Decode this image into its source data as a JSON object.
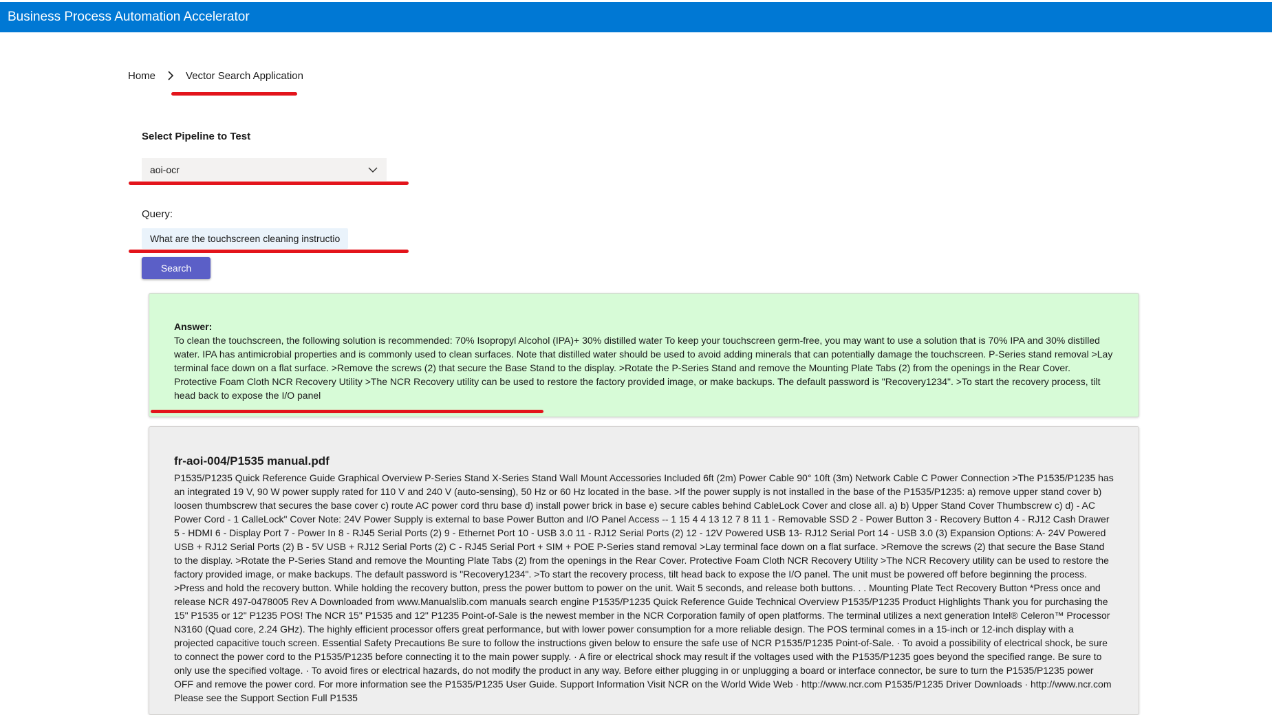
{
  "header": {
    "title": "Business Process Automation Accelerator"
  },
  "breadcrumb": {
    "home": "Home",
    "current": "Vector Search Application"
  },
  "pipeline": {
    "label": "Select Pipeline to Test",
    "selected": "aoi-ocr"
  },
  "query": {
    "label": "Query:",
    "value": "What are the touchscreen cleaning instructio"
  },
  "search_button": {
    "label": "Search"
  },
  "answer": {
    "label": "Answer:",
    "text": "To clean the touchscreen, the following solution is recommended: 70% Isopropyl Alcohol (IPA)+ 30% distilled water To keep your touchscreen germ-free, you may want to use a solution that is 70% IPA and 30% distilled water. IPA has antimicrobial properties and is commonly used to clean surfaces. Note that distilled water should be used to avoid adding minerals that can potentially damage the touchscreen. P-Series stand removal >Lay terminal face down on a flat surface. >Remove the screws (2) that secure the Base Stand to the display. >Rotate the P-Series Stand and remove the Mounting Plate Tabs (2) from the openings in the Rear Cover. Protective Foam Cloth NCR Recovery Utility >The NCR Recovery utility can be used to restore the factory provided image, or make backups. The default password is \"Recovery1234\". >To start the recovery process, tilt head back to expose the I/O panel"
  },
  "result": {
    "title": "fr-aoi-004/P1535 manual.pdf",
    "text": "P1535/P1235 Quick Reference Guide Graphical Overview P-Series Stand X-Series Stand Wall Mount Accessories Included 6ft (2m) Power Cable 90° 10ft (3m) Network Cable C Power Connection >The P1535/P1235 has an integrated 19 V, 90 W power supply rated for 110 V and 240 V (auto-sensing), 50 Hz or 60 Hz located in the base. >If the power supply is not installed in the base of the P1535/P1235: a) remove upper stand cover b) loosen thumbscrew that secures the base cover c) route AC power cord thru base d) install power brick in base e) secure cables behind CableLock Cover and close all. a) b) Upper Stand Cover Thumbscrew c) d) - AC Power Cord - 1 CalleLock\" Cover Note: 24V Power Supply is external to base Power Button and I/O Panel Access -- 1 15 4 4 13 12 7 8 11 1 - Removable SSD 2 - Power Button 3 - Recovery Button 4 - RJ12 Cash Drawer 5 - HDMI 6 - Display Port 7 - Power In 8 - RJ45 Serial Ports (2) 9 - Ethernet Port 10 - USB 3.0 11 - RJ12 Serial Ports (2) 12 - 12V Powered USB 13- RJ12 Serial Port 14 - USB 3.0 (3) Expansion Options: A- 24V Powered USB + RJ12 Serial Ports (2) B - 5V USB + RJ12 Serial Ports (2) C - RJ45 Serial Port + SIM + POE P-Series stand removal >Lay terminal face down on a flat surface. >Remove the screws (2) that secure the Base Stand to the display. >Rotate the P-Series Stand and remove the Mounting Plate Tabs (2) from the openings in the Rear Cover. Protective Foam Cloth NCR Recovery Utility >The NCR Recovery utility can be used to restore the factory provided image, or make backups. The default password is \"Recovery1234\". >To start the recovery process, tilt head back to expose the I/O panel. The unit must be powered off before beginning the process. >Press and hold the recovery button. While holding the recovery button, press the power buttom to power on the unit. Wait 5 seconds, and release both buttons. . . Mounting Plate Tect Recovery Button *Press once and release NCR 497-0478005 Rev A Downloaded from www.Manualslib.com manuals search engine P1535/P1235 Quick Reference Guide Technical Overview P1535/P1235 Product Highlights Thank you for purchasing the 15\" P1535 or 12\" P1235 POS! The NCR 15\" P1535 and 12\" P1235 Point-of-Sale is the newest member in the NCR Corporation family of open platforms. The terminal utilizes a next generation Intel® Celeron™ Processor N3160 (Quad core, 2.24 GHz). The highly efficient processor offers great performance, but with lower power consumption for a more reliable design. The POS terminal comes in a 15-inch or 12-inch display with a projected capacitive touch screen. Essential Safety Precautions Be sure to follow the instructions given below to ensure the safe use of NCR P1535/P1235 Point-of-Sale. · To avoid a possibility of electrical shock, be sure to connect the power cord to the P1535/P1235 before connecting it to the main power supply. · A fire or electrical shock may result if the voltages used with the P1535/P1235 goes beyond the specified range. Be sure to only use the specified voltage. · To avoid fires or electrical hazards, do not modify the product in any way. Before either plugging in or unplugging a board or interface connector, be sure to turn the P1535/P1235 power OFF and remove the power cord. For more information see the P1535/P1235 User Guide. Support Information Visit NCR on the World Wide Web · http://www.ncr.com P1535/P1235 Driver Downloads · http://www.ncr.com Please see the Support Section Full P1535"
  },
  "colors": {
    "topbar": "#0078d4",
    "button": "#5b5fc7",
    "annotation": "#e3141b",
    "answer_bg": "#d7fbd7",
    "result_bg": "#eeeeee"
  }
}
